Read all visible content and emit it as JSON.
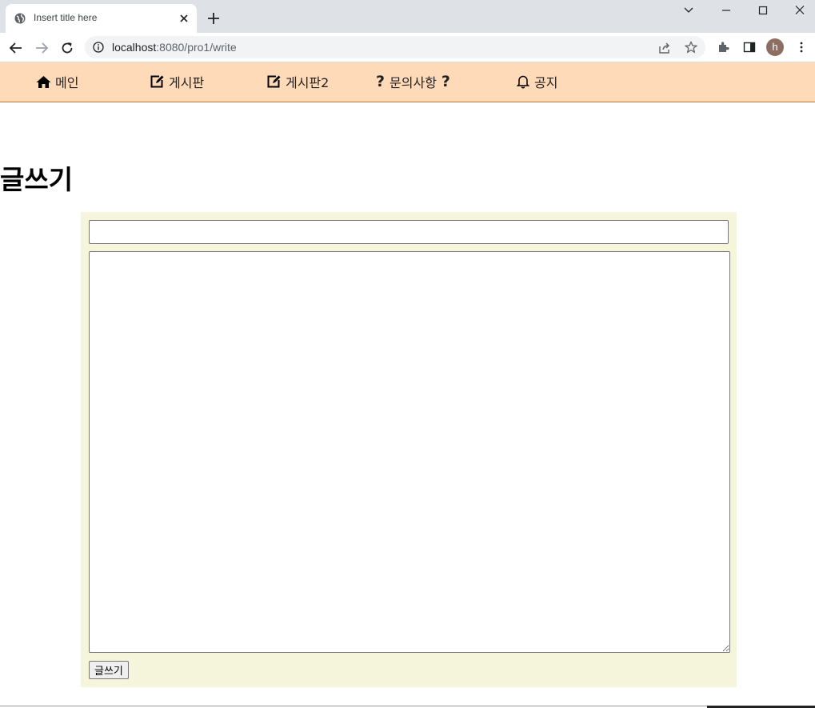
{
  "browser": {
    "tab_title": "Insert title here",
    "url_host": "localhost",
    "url_path": ":8080/pro1/write",
    "avatar_letter": "h"
  },
  "nav": {
    "items": [
      {
        "label": "메인",
        "icon": "home-icon"
      },
      {
        "label": "게시판",
        "icon": "edit-icon"
      },
      {
        "label": "게시판2",
        "icon": "edit-icon"
      },
      {
        "label": "문의사항",
        "icon": "question-icon"
      },
      {
        "label": "공지",
        "icon": "bell-icon"
      }
    ],
    "question_mark": "?"
  },
  "page": {
    "title": "글쓰기"
  },
  "form": {
    "title_value": "",
    "content_value": "",
    "submit_label": "글쓰기"
  },
  "colors": {
    "nav_bg": "#ffdab9",
    "form_bg": "#f5f5dc"
  }
}
